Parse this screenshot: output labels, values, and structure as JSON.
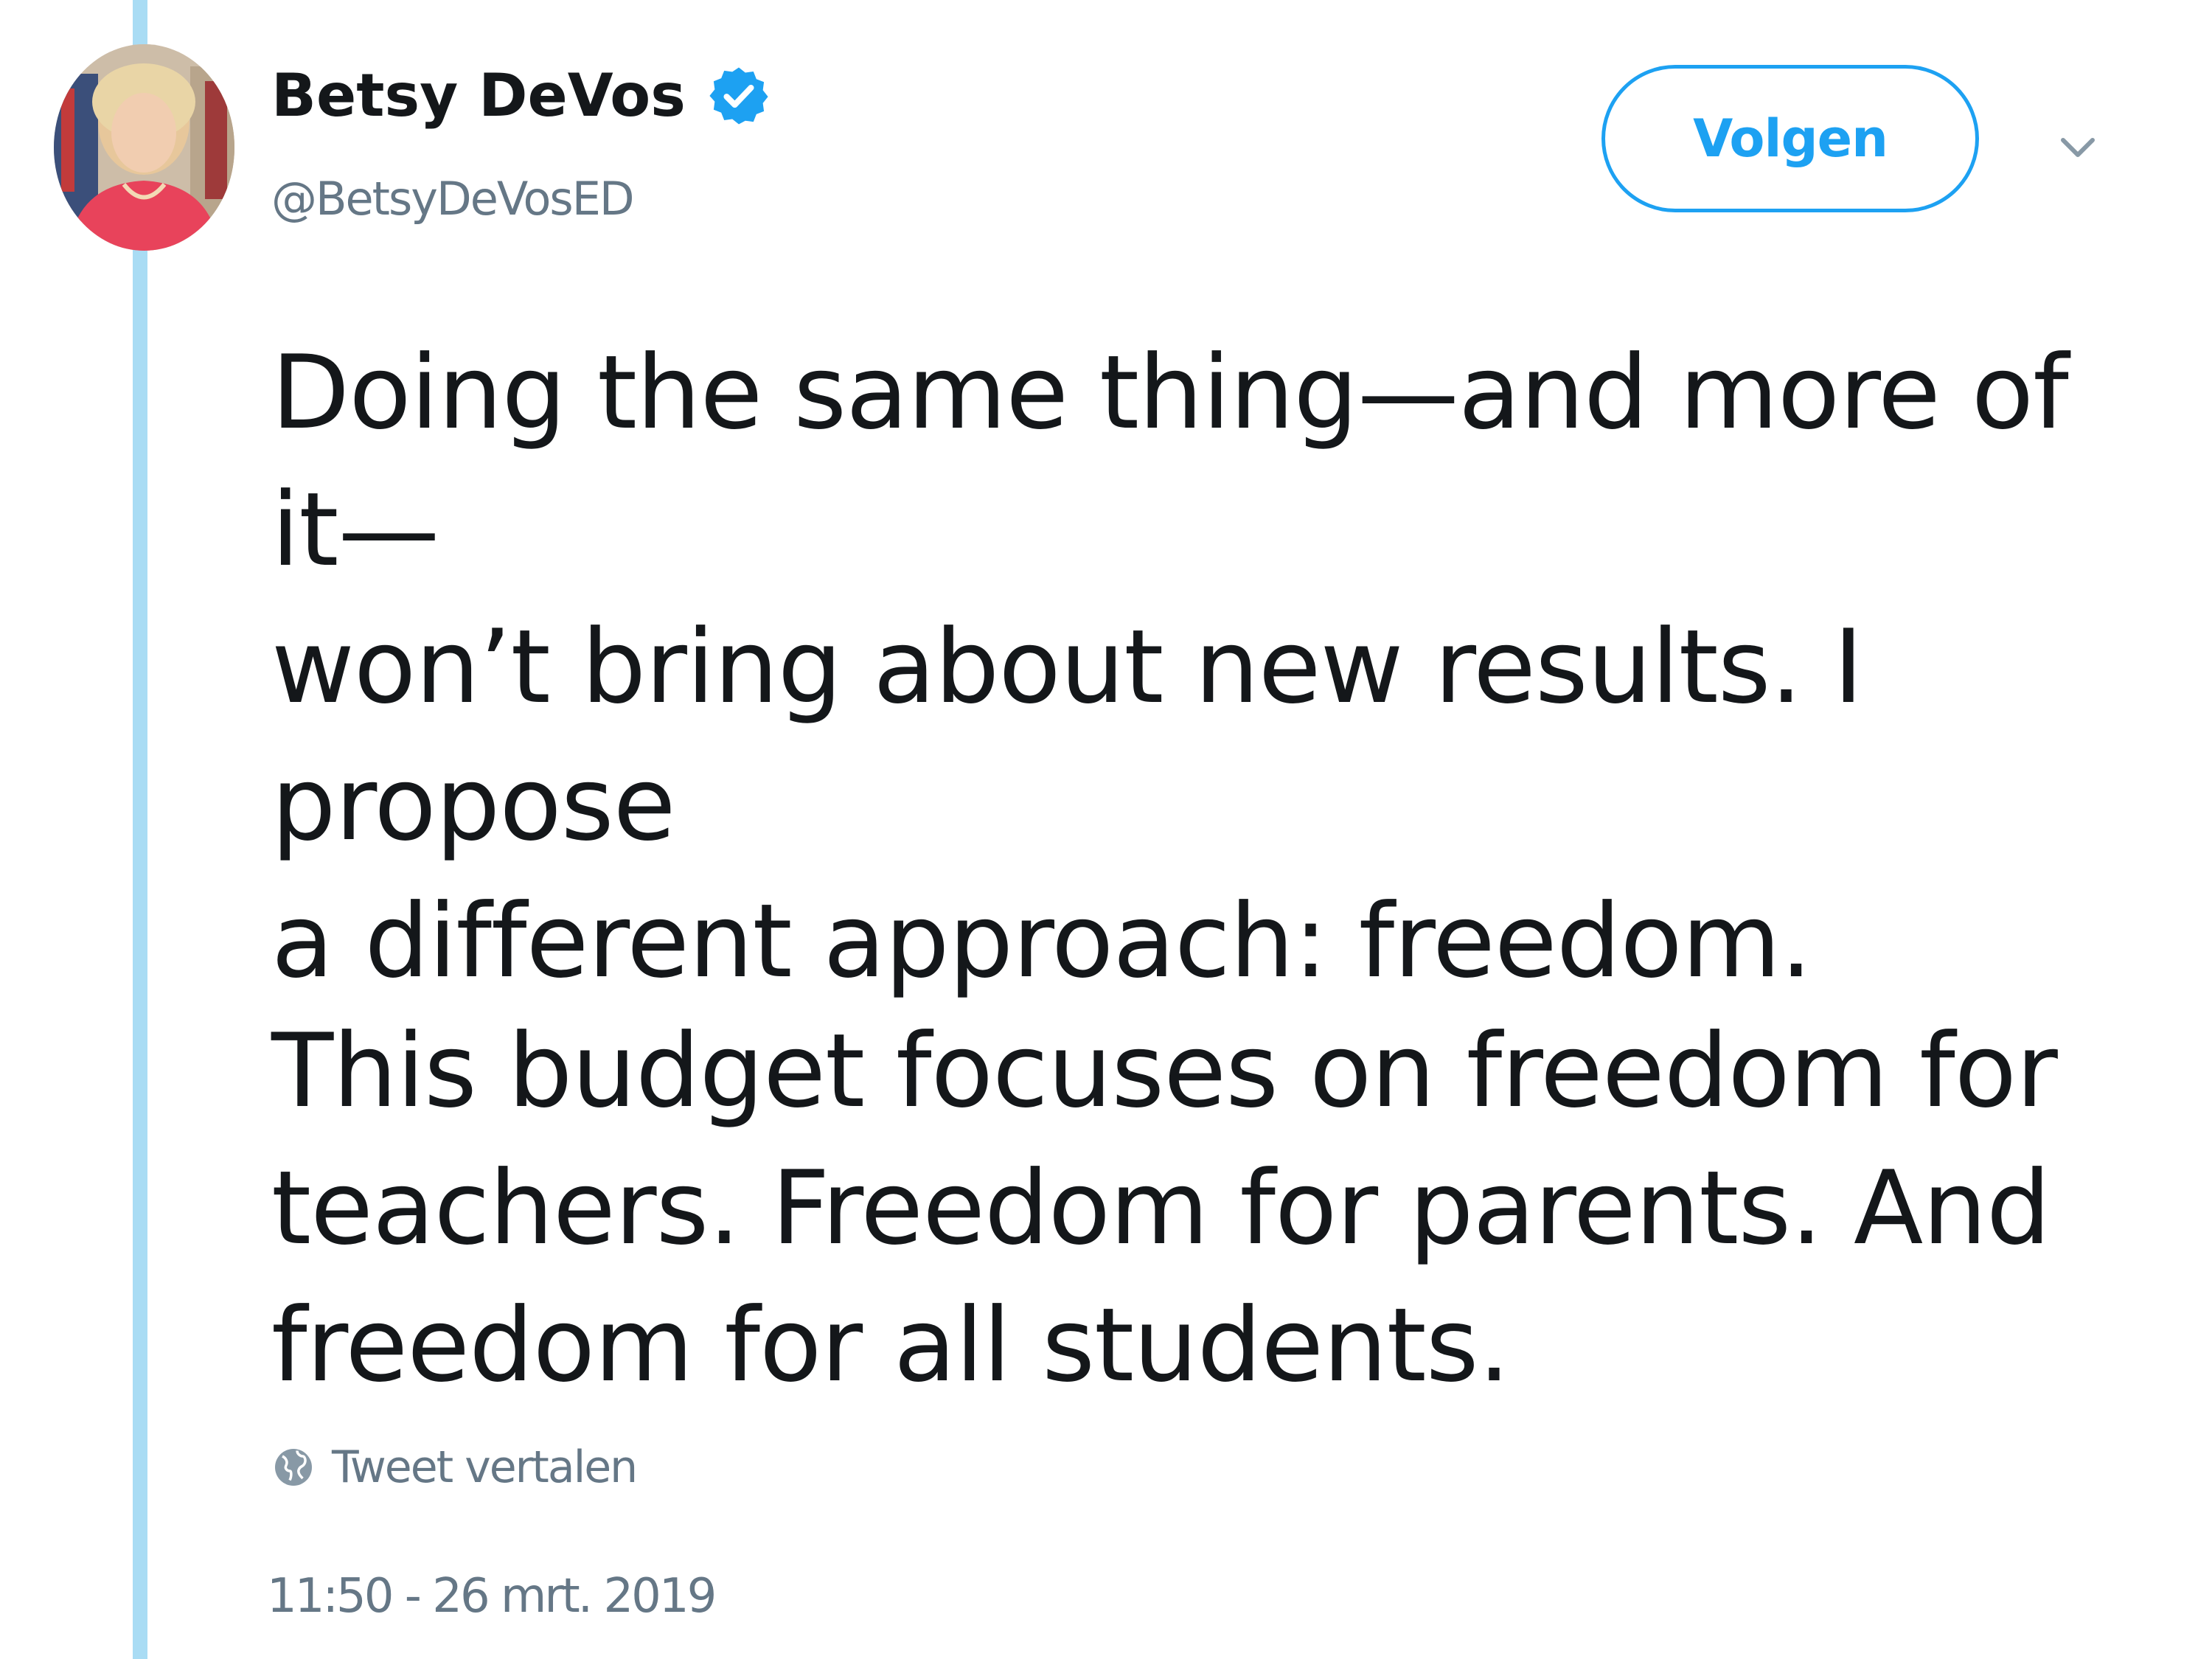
{
  "tweet": {
    "author": {
      "display_name": "Betsy DeVos",
      "handle": "@BetsyDeVosED",
      "verified": true,
      "verified_icon": "verified-badge-icon",
      "avatar_icon": "profile-photo"
    },
    "follow_button_label": "Volgen",
    "menu_icon": "chevron-down-icon",
    "text_paragraph_1": "Doing the same thing—and more of it—\nwon’t bring about new results. I propose\na different approach: freedom.",
    "text_paragraph_2": "This budget focuses on freedom for\nteachers. Freedom for parents. And\nfreedom for all students.",
    "translate_label": "Tweet vertalen",
    "translate_icon": "globe-icon",
    "timestamp": "11:50 - 26 mrt. 2019"
  },
  "colors": {
    "accent": "#1da1f2",
    "thread_line": "#a9dcf4",
    "muted_text": "#657786",
    "primary_text": "#14171a"
  }
}
